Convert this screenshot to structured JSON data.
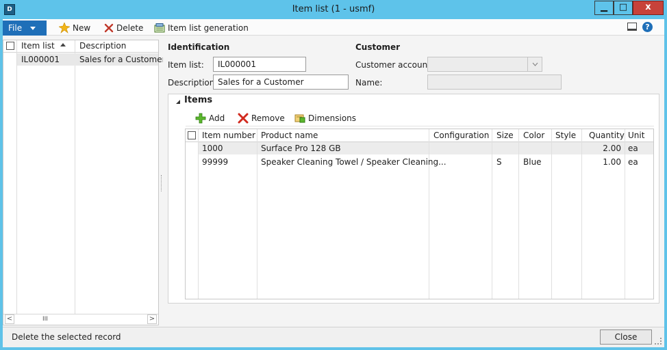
{
  "window": {
    "title": "Item list (1 - usmf)",
    "app_icon_text": "D",
    "min_glyph": "▁",
    "max_glyph": "□",
    "close_glyph": "x"
  },
  "toolbar": {
    "file_label": "File",
    "new_label": "New",
    "delete_label": "Delete",
    "generation_label": "Item list generation",
    "help_glyph": "?"
  },
  "left_list": {
    "headers": {
      "item_list": "Item list",
      "description": "Description"
    },
    "rows": [
      {
        "item_list": "IL000001",
        "description": "Sales for a Customer"
      }
    ],
    "scroll_thumb": "III",
    "scroll_left": "<",
    "scroll_right": ">"
  },
  "form": {
    "identification_label": "Identification",
    "customer_label": "Customer",
    "item_list_label": "Item list:",
    "item_list_value": "IL000001",
    "description_label": "Description:",
    "description_value": "Sales for a Customer",
    "customer_account_label": "Customer account:",
    "customer_account_value": "",
    "name_label": "Name:",
    "name_value": ""
  },
  "items": {
    "section_label": "Items",
    "add_label": "Add",
    "remove_label": "Remove",
    "dimensions_label": "Dimensions",
    "columns": {
      "item_number": "Item number",
      "product_name": "Product name",
      "configuration": "Configuration",
      "size": "Size",
      "color": "Color",
      "style": "Style",
      "quantity": "Quantity",
      "unit": "Unit"
    },
    "rows": [
      {
        "item_number": "1000",
        "product_name": "Surface Pro 128 GB",
        "configuration": "",
        "size": "",
        "color": "",
        "style": "",
        "quantity": "2.00",
        "unit": "ea"
      },
      {
        "item_number": "99999",
        "product_name": "Speaker Cleaning Towel / Speaker Cleaning...",
        "configuration": "",
        "size": "S",
        "color": "Blue",
        "style": "",
        "quantity": "1.00",
        "unit": "ea"
      }
    ]
  },
  "status": {
    "text": "Delete the selected record",
    "close_label": "Close"
  },
  "colors": {
    "title_bar": "#5ec3ea",
    "file_button": "#1f6fb8",
    "close_window": "#c7423a",
    "selected_row": "#e8e8e8"
  },
  "icons": {
    "new": "new-star-icon",
    "delete": "delete-x-icon",
    "generation": "item-list-generation-icon",
    "add": "add-plus-icon",
    "remove": "remove-x-icon",
    "dimensions": "dimensions-icon",
    "help": "help-icon",
    "view": "view-toggle-icon"
  }
}
